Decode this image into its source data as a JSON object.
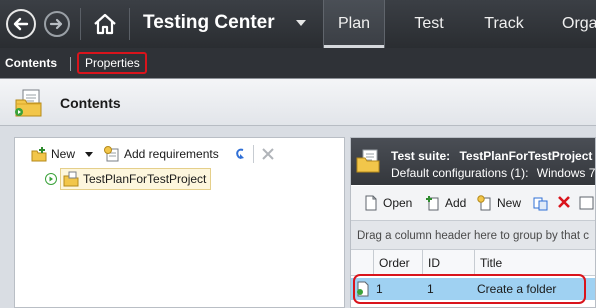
{
  "topbar": {
    "back_icon": "back-arrow-circle-icon",
    "forward_icon": "forward-arrow-circle-icon",
    "home_icon": "home-icon",
    "app_title": "Testing Center",
    "tabs": [
      {
        "label": "Plan",
        "active": true
      },
      {
        "label": "Test",
        "active": false
      },
      {
        "label": "Track",
        "active": false
      },
      {
        "label": "Orga",
        "active": false
      }
    ]
  },
  "subbar": {
    "contents_label": "Contents",
    "properties_label": "Properties"
  },
  "header": {
    "title": "Contents"
  },
  "left_toolbar": {
    "new_label": "New",
    "add_requirements_label": "Add requirements"
  },
  "tree": {
    "root_label": "TestPlanForTestProject"
  },
  "suite": {
    "title_prefix": "Test suite:",
    "title_name": "TestPlanForTestProject",
    "config_label": "Default configurations (1):",
    "config_value": "Windows 7"
  },
  "right_toolbar": {
    "open_label": "Open",
    "add_label": "Add",
    "new_label": "New"
  },
  "grid": {
    "group_hint": "Drag a column header here to group by that c",
    "columns": [
      "Order",
      "ID",
      "Title"
    ],
    "rows": [
      {
        "order": "1",
        "id": "1",
        "title": "Create a folder"
      }
    ]
  },
  "colors": {
    "topbar": "#2f3237",
    "highlight_box": "#d9141c",
    "selected_row": "#9fd1f2"
  }
}
